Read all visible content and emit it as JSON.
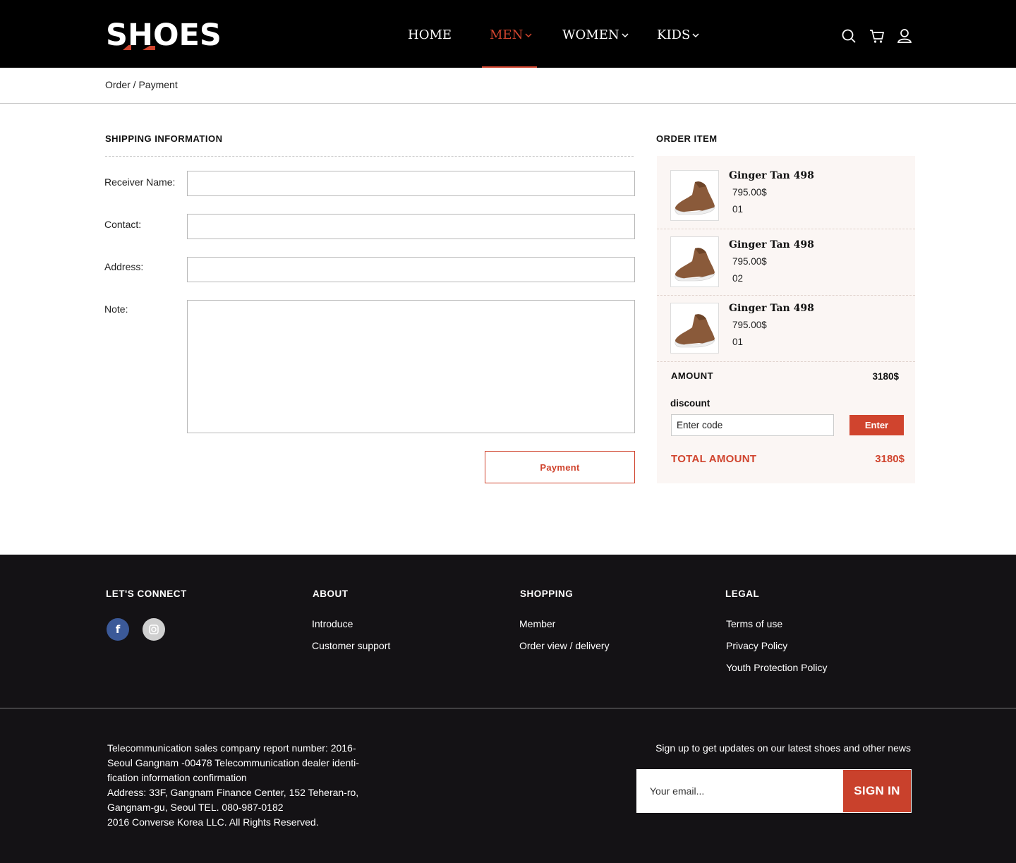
{
  "header": {
    "logo_text": "SHOES",
    "nav": [
      {
        "label": "HOME",
        "active": false,
        "has_dropdown": false
      },
      {
        "label": "MEN",
        "active": true,
        "has_dropdown": true
      },
      {
        "label": "WOMEN",
        "active": false,
        "has_dropdown": true
      },
      {
        "label": "KIDS",
        "active": false,
        "has_dropdown": true
      }
    ],
    "icons": [
      "search-icon",
      "cart-icon",
      "user-icon"
    ]
  },
  "breadcrumb": "Order / Payment",
  "shipping": {
    "title": "SHIPPING INFORMATION",
    "fields": [
      {
        "label": "Receiver Name:",
        "value": ""
      },
      {
        "label": "Contact:",
        "value": ""
      },
      {
        "label": "Address:",
        "value": ""
      },
      {
        "label": "Note:",
        "value": ""
      }
    ],
    "payment_button": "Payment"
  },
  "order": {
    "title": "ORDER ITEM",
    "items": [
      {
        "name": "Ginger Tan 498",
        "price": "795.00$",
        "qty": "01"
      },
      {
        "name": "Ginger Tan 498",
        "price": "795.00$",
        "qty": "02"
      },
      {
        "name": "Ginger Tan 498",
        "price": "795.00$",
        "qty": "01"
      }
    ],
    "amount_label": "AMOUNT",
    "amount_value": "3180$",
    "discount_label": "discount",
    "discount_placeholder": "Enter code",
    "enter_button": "Enter",
    "total_label": "TOTAL AMOUNT",
    "total_value": "3180$"
  },
  "footer": {
    "columns": [
      {
        "title": "LET'S CONNECT",
        "links": []
      },
      {
        "title": "ABOUT",
        "links": [
          "Introduce",
          "Customer support"
        ]
      },
      {
        "title": "SHOPPING",
        "links": [
          "Member",
          "Order view / delivery"
        ]
      },
      {
        "title": "LEGAL",
        "links": [
          "Terms of use",
          "Privacy Policy",
          "Youth Protection Policy"
        ]
      }
    ],
    "social": [
      "facebook-icon",
      "instagram-icon"
    ],
    "legal_lines": [
      "Telecommunication sales company report number: 2016-",
      "Seoul Gangnam -00478 Telecommunication dealer identi-",
      "fication information confirmation",
      "Address: 33F, Gangnam Finance Center, 152 Teheran-ro,",
      "Gangnam-gu, Seoul TEL. 080-987-0182",
      "2016 Converse Korea LLC. All Rights Reserved."
    ],
    "newsletter_text": "Sign up to get updates on our latest shoes and other news",
    "email_placeholder": "Your email...",
    "signin_button": "SIGN IN"
  },
  "colors": {
    "accent": "#d0442e",
    "header_bg": "#000000",
    "footer_bg": "#141215",
    "panel_bg": "#fbf6f4"
  }
}
